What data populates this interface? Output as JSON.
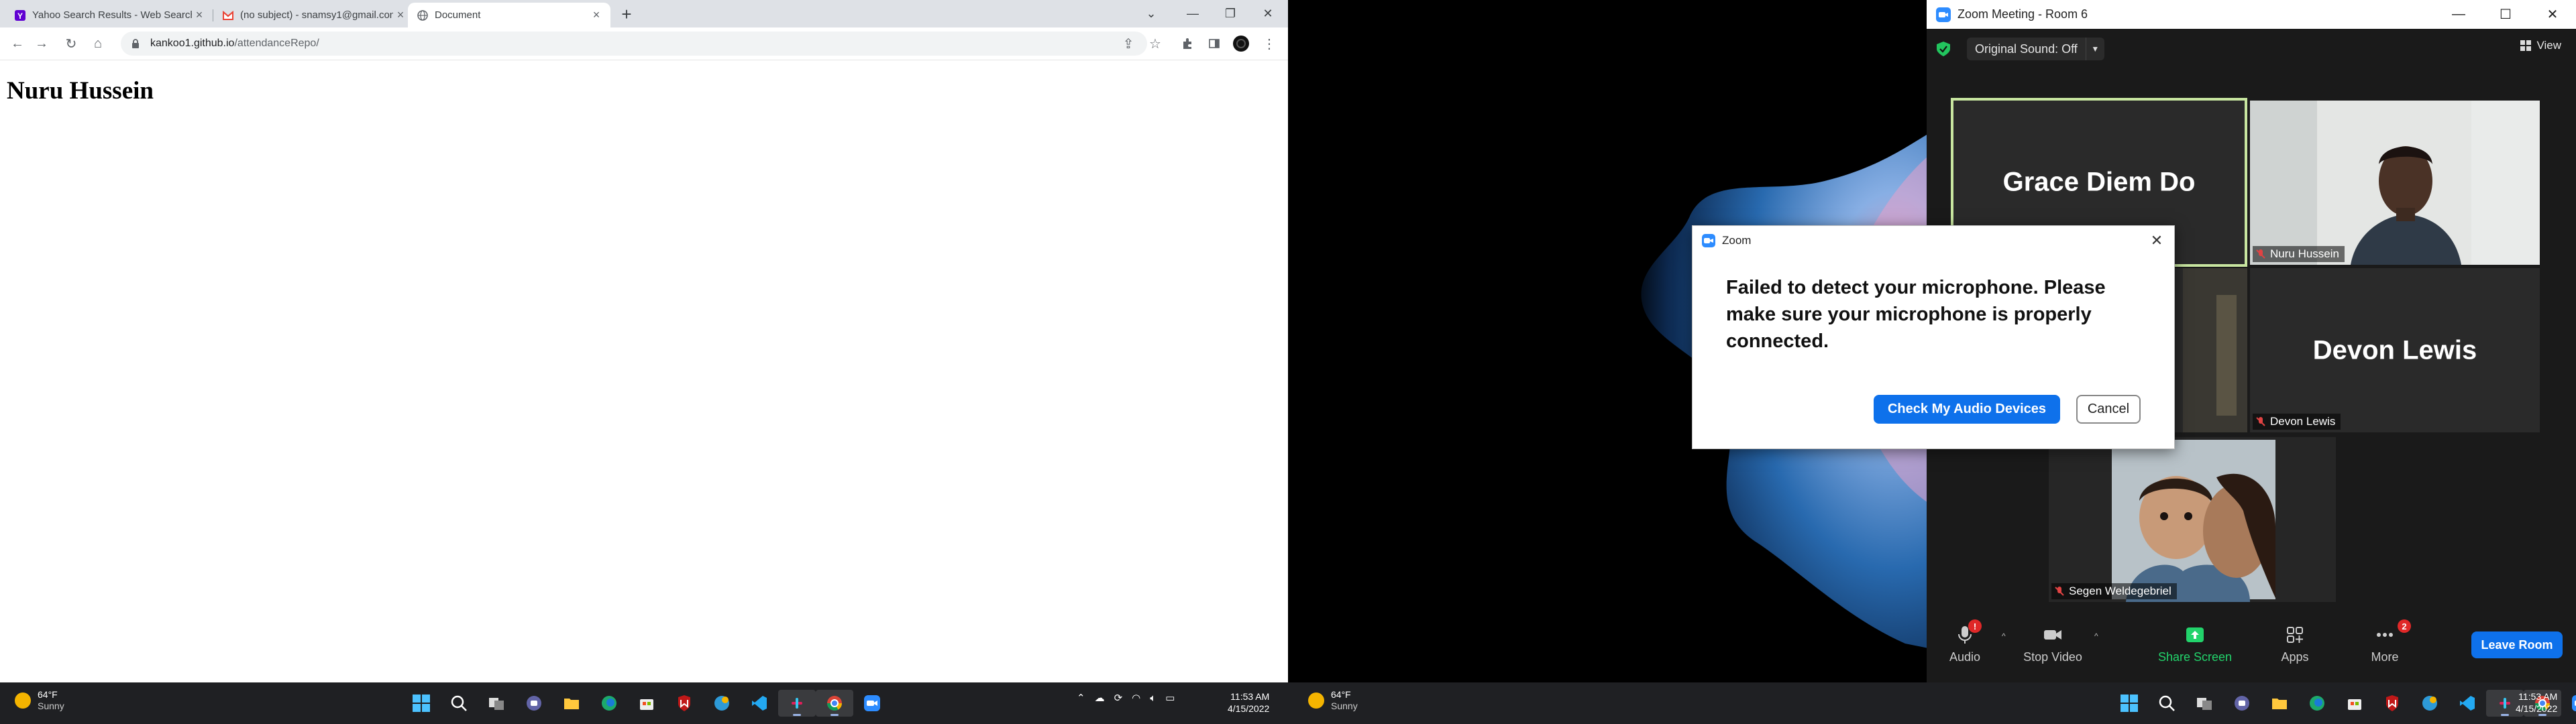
{
  "browser": {
    "tabs": [
      {
        "label": "Yahoo Search Results - Web Search",
        "icon": "yahoo-icon"
      },
      {
        "label": "(no subject) - snamsy1@gmail.com",
        "icon": "gmail-icon"
      },
      {
        "label": "Document",
        "icon": "globe-icon"
      }
    ],
    "new_tab_label": "+",
    "url_host": "kankoo1.github.io",
    "url_path": "/attendanceRepo/"
  },
  "page": {
    "heading": "Nuru Hussein"
  },
  "taskbar_left": {
    "temperature": "64°F",
    "condition": "Sunny",
    "time": "11:53 AM",
    "date": "4/15/2022"
  },
  "taskbar_right": {
    "temperature": "64°F",
    "condition": "Sunny",
    "time": "11:53 AM",
    "date": "4/15/2022"
  },
  "zoom": {
    "window_title": "Zoom Meeting - Room 6",
    "original_sound": "Original Sound: Off",
    "view_label": "View",
    "participants": [
      {
        "name": "Grace Diem Do",
        "video": false,
        "speaking": true
      },
      {
        "name": "Nuru Hussein",
        "video": true,
        "muted": true
      },
      {
        "name": "Devon Lewis",
        "video": false,
        "muted": true
      },
      {
        "name": "Segen Weldegebriel",
        "video": true,
        "muted": true
      }
    ],
    "controls": {
      "audio": "Audio",
      "audio_badge": "!",
      "stop_video": "Stop Video",
      "share_screen": "Share Screen",
      "apps": "Apps",
      "more": "More",
      "more_badge": "2",
      "leave": "Leave Room"
    },
    "dialog": {
      "title": "Zoom",
      "message": "Failed to detect your microphone. Please make sure your microphone is properly connected.",
      "primary_button": "Check My Audio Devices",
      "cancel_button": "Cancel"
    }
  },
  "colors": {
    "zoom_blue": "#0e71eb",
    "share_green": "#22d36b",
    "speaker_outline": "#c8e6a0",
    "taskbar": "#1f2023"
  }
}
